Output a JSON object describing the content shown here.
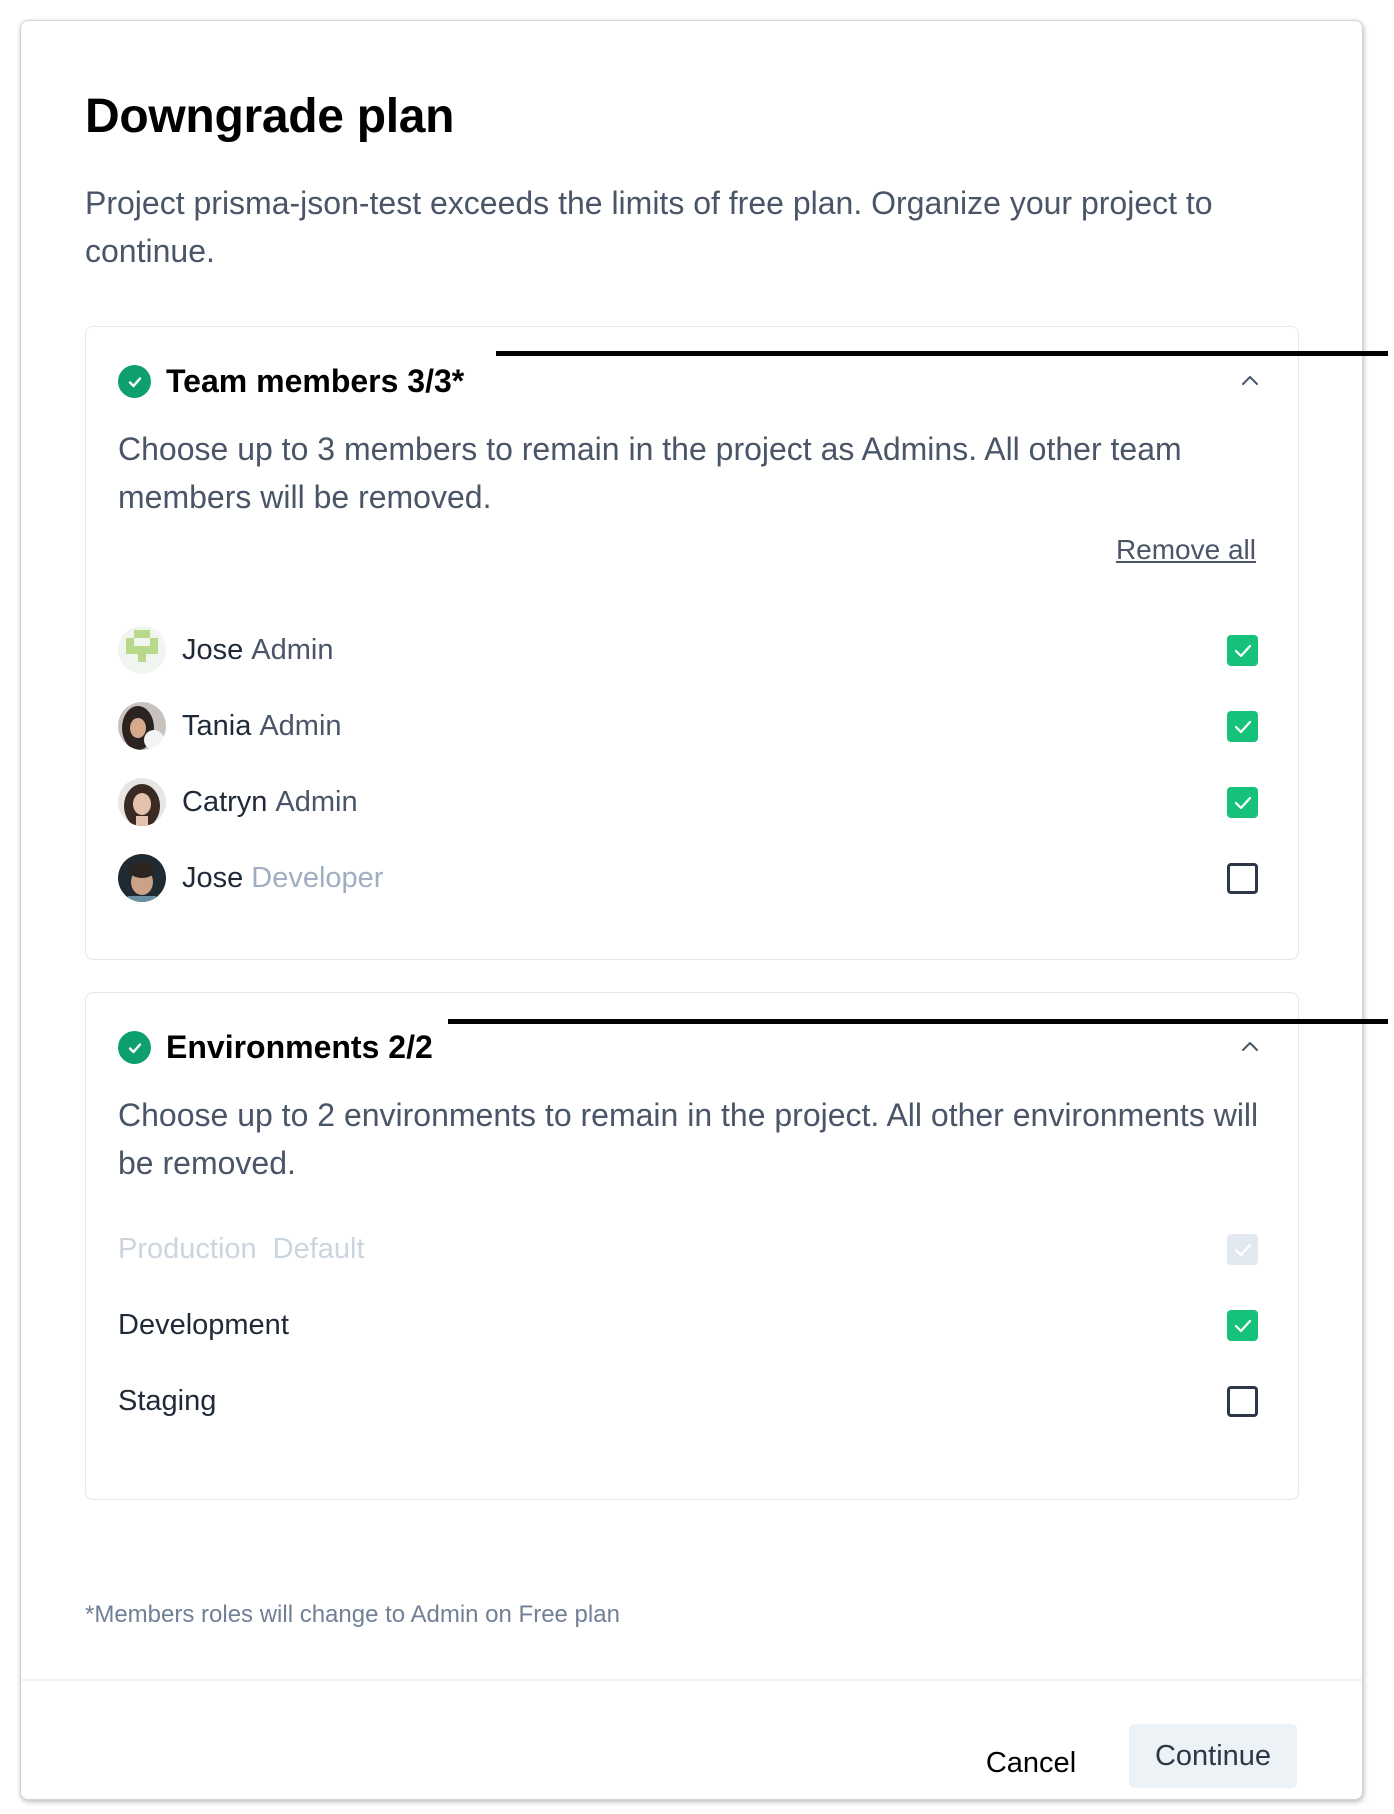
{
  "dialog": {
    "title": "Downgrade plan",
    "description": "Project prisma-json-test exceeds the limits of free plan. Organize your project to continue."
  },
  "team_section": {
    "title": "Team members 3/3*",
    "description": "Choose up to 3 members to remain in the project as Admins. All other team members will be removed.",
    "remove_all_label": "Remove all",
    "members": [
      {
        "name": "Jose",
        "role": "Admin",
        "checked": true,
        "avatar": "pixel-avatar-icon"
      },
      {
        "name": "Tania",
        "role": "Admin",
        "checked": true,
        "avatar": "user-photo-avatar"
      },
      {
        "name": "Catryn",
        "role": "Admin",
        "checked": true,
        "avatar": "user-photo-avatar"
      },
      {
        "name": "Jose",
        "role": "Developer",
        "checked": false,
        "avatar": "user-photo-avatar"
      }
    ]
  },
  "env_section": {
    "title": "Environments 2/2",
    "description": "Choose up to 2 environments to remain in the project. All other environments will be removed.",
    "environments": [
      {
        "name": "Production",
        "tag": "Default",
        "checked": true,
        "disabled": true
      },
      {
        "name": "Development",
        "tag": "",
        "checked": true,
        "disabled": false
      },
      {
        "name": "Staging",
        "tag": "",
        "checked": false,
        "disabled": false
      }
    ]
  },
  "footnote": "*Members roles will change to Admin on Free plan",
  "buttons": {
    "cancel": "Cancel",
    "continue": "Continue"
  },
  "colors": {
    "success": "#0e9f6e",
    "checkbox_checked": "#16c27a",
    "checkbox_disabled": "#e2e8f0",
    "secondary_button_bg": "#edf2f7"
  }
}
